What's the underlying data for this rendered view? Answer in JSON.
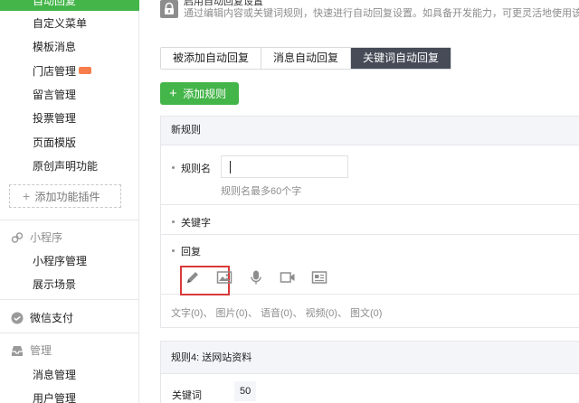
{
  "sidebar": {
    "active_item": "自动回复",
    "items": [
      "自定义菜单",
      "模板消息",
      "门店管理",
      "留言管理",
      "投票管理",
      "页面模版",
      "原创声明功能"
    ],
    "add_plugin": "添加功能插件",
    "mini_program": {
      "heading": "小程序",
      "items": [
        "小程序管理",
        "展示场景"
      ]
    },
    "wechat_pay": "微信支付",
    "manage": {
      "heading": "管理",
      "items": [
        "消息管理",
        "用户管理"
      ]
    }
  },
  "notice": {
    "title": "启用自动回复设置",
    "text": "通过编辑内容或关键词规则，快速进行自动回复设置。如具备开发能力，可更灵活地使用该"
  },
  "tabs": [
    "被添加自动回复",
    "消息自动回复",
    "关键词自动回复"
  ],
  "selected_tab": "关键词自动回复",
  "add_rule_label": "添加规则",
  "new_rule": {
    "header": "新规则",
    "name_label": "规则名",
    "name_value": "",
    "name_hint": "规则名最多60个字",
    "keyword_label": "关键字",
    "reply_label": "回复",
    "tools": [
      "pencil-icon",
      "image-icon",
      "microphone-icon",
      "video-icon",
      "article-icon"
    ],
    "counts": "文字(0)、 图片(0)、 语音(0)、 视频(0)、 图文(0)"
  },
  "rule4": {
    "header": "规则4: 送网站资料",
    "keyword_label": "关键词",
    "keyword_value": "50"
  },
  "colors": {
    "accent_green": "#44b549",
    "tab_selected": "#464b57",
    "highlight_red": "#d93a3a"
  }
}
